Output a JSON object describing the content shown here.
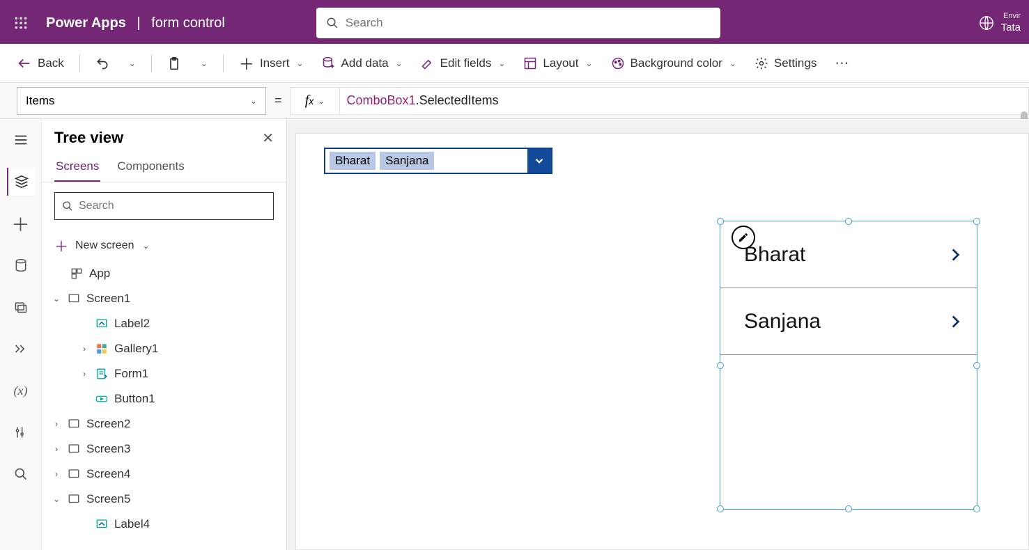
{
  "header": {
    "brand": "Power Apps",
    "app_name": "form control",
    "search_placeholder": "Search",
    "env_label": "Envir",
    "env_value": "Tata"
  },
  "ribbon": {
    "back": "Back",
    "insert": "Insert",
    "add_data": "Add data",
    "edit_fields": "Edit fields",
    "layout": "Layout",
    "bg_color": "Background color",
    "settings": "Settings"
  },
  "propbar": {
    "property": "Items",
    "formula_obj": "ComboBox1",
    "formula_rest": ".SelectedItems"
  },
  "tree": {
    "title": "Tree view",
    "tab_screens": "Screens",
    "tab_components": "Components",
    "search_placeholder": "Search",
    "new_screen": "New screen",
    "items": [
      {
        "label": "App",
        "icon": "app"
      },
      {
        "label": "Screen1",
        "icon": "screen",
        "expand": "down",
        "children": [
          {
            "label": "Label2",
            "icon": "label"
          },
          {
            "label": "Gallery1",
            "icon": "gallery",
            "expand": "right"
          },
          {
            "label": "Form1",
            "icon": "form",
            "expand": "right"
          },
          {
            "label": "Button1",
            "icon": "button"
          }
        ]
      },
      {
        "label": "Screen2",
        "icon": "screen",
        "expand": "right"
      },
      {
        "label": "Screen3",
        "icon": "screen",
        "expand": "right"
      },
      {
        "label": "Screen4",
        "icon": "screen",
        "expand": "right"
      },
      {
        "label": "Screen5",
        "icon": "screen",
        "expand": "down",
        "children": [
          {
            "label": "Label4",
            "icon": "label"
          }
        ]
      }
    ]
  },
  "combo": {
    "chips": [
      "Bharat",
      "Sanjana"
    ]
  },
  "gallery": {
    "items": [
      "Bharat",
      "Sanjana"
    ]
  }
}
